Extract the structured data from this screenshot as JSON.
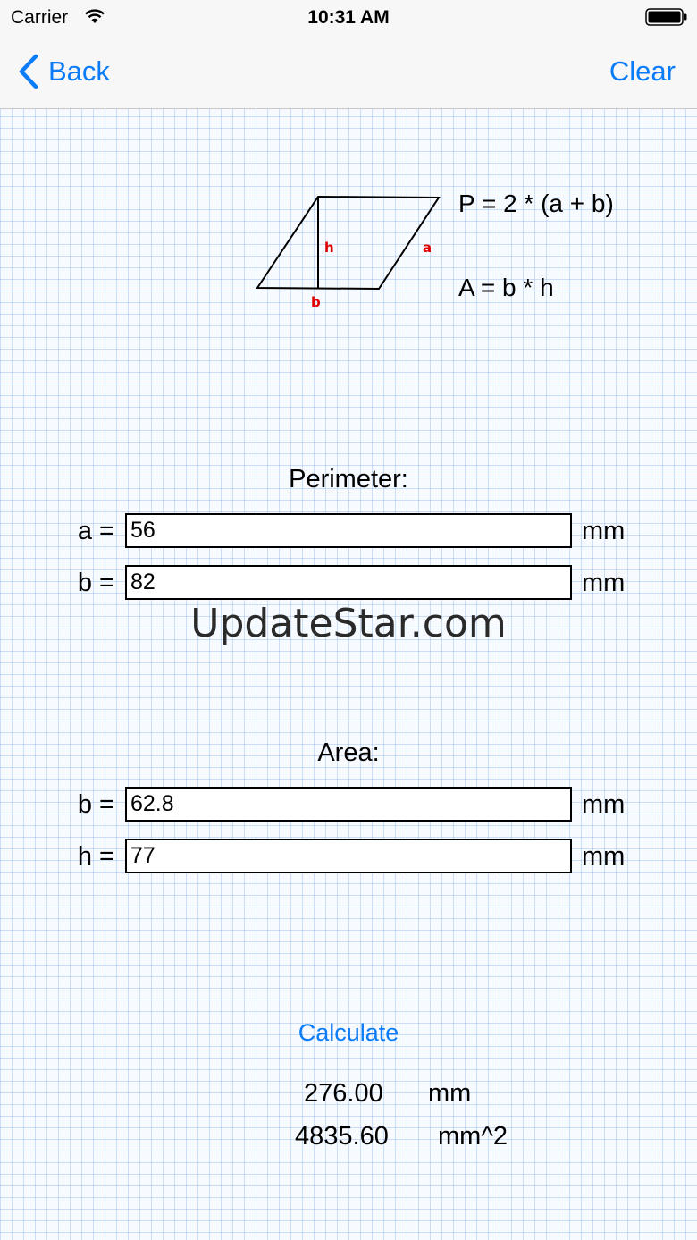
{
  "status": {
    "carrier": "Carrier",
    "time": "10:31 AM"
  },
  "nav": {
    "back_label": "Back",
    "clear_label": "Clear"
  },
  "diagram": {
    "label_h": "h",
    "label_a": "a",
    "label_b": "b",
    "formula_perimeter": "P = 2 * (a + b)",
    "formula_area": "A = b * h"
  },
  "perimeter": {
    "title": "Perimeter:",
    "a_label": "a =",
    "a_value": "56",
    "a_unit": "mm",
    "b_label": "b =",
    "b_value": "82",
    "b_unit": "mm"
  },
  "watermark": "UpdateStar.com",
  "area": {
    "title": "Area:",
    "b_label": "b =",
    "b_value": "62.8",
    "b_unit": "mm",
    "h_label": "h =",
    "h_value": "77",
    "h_unit": "mm"
  },
  "calculate_label": "Calculate",
  "results": {
    "perimeter_value": "276.00",
    "perimeter_unit": "mm",
    "area_value": "4835.60",
    "area_unit": "mm^2"
  },
  "colors": {
    "accent": "#0a7cf7",
    "label_red": "#e00000",
    "grid": "#a8c8ec"
  }
}
